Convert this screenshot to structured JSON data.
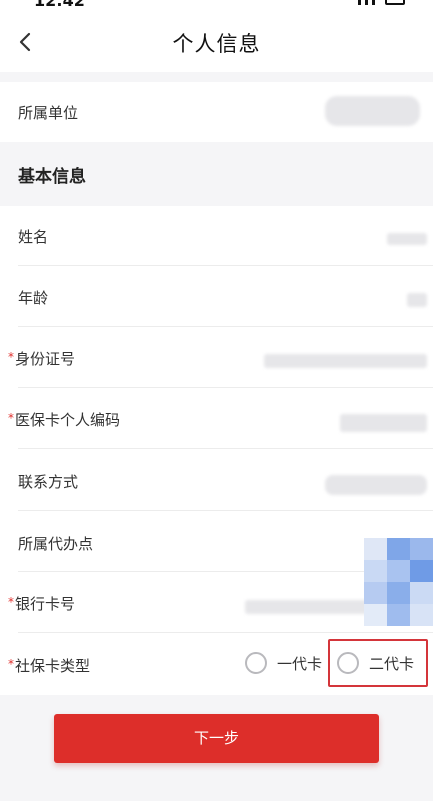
{
  "status": {
    "time": "12:42"
  },
  "nav": {
    "title": "个人信息"
  },
  "unit_row": {
    "label": "所属单位"
  },
  "section": {
    "title": "基本信息"
  },
  "fields": {
    "name": "姓名",
    "age": "年龄",
    "id_card": "身份证号",
    "medical_card": "医保卡个人编码",
    "contact": "联系方式",
    "agency": "所属代办点",
    "bank_card": "银行卡号",
    "card_type": "社保卡类型"
  },
  "required_mark": "*",
  "card_type_options": {
    "first": "一代卡",
    "second": "二代卡"
  },
  "actions": {
    "next_label": "下一步"
  },
  "colors": {
    "accent": "#dd2e2a",
    "required": "#e0312e",
    "highlight_border": "#d4353a"
  }
}
